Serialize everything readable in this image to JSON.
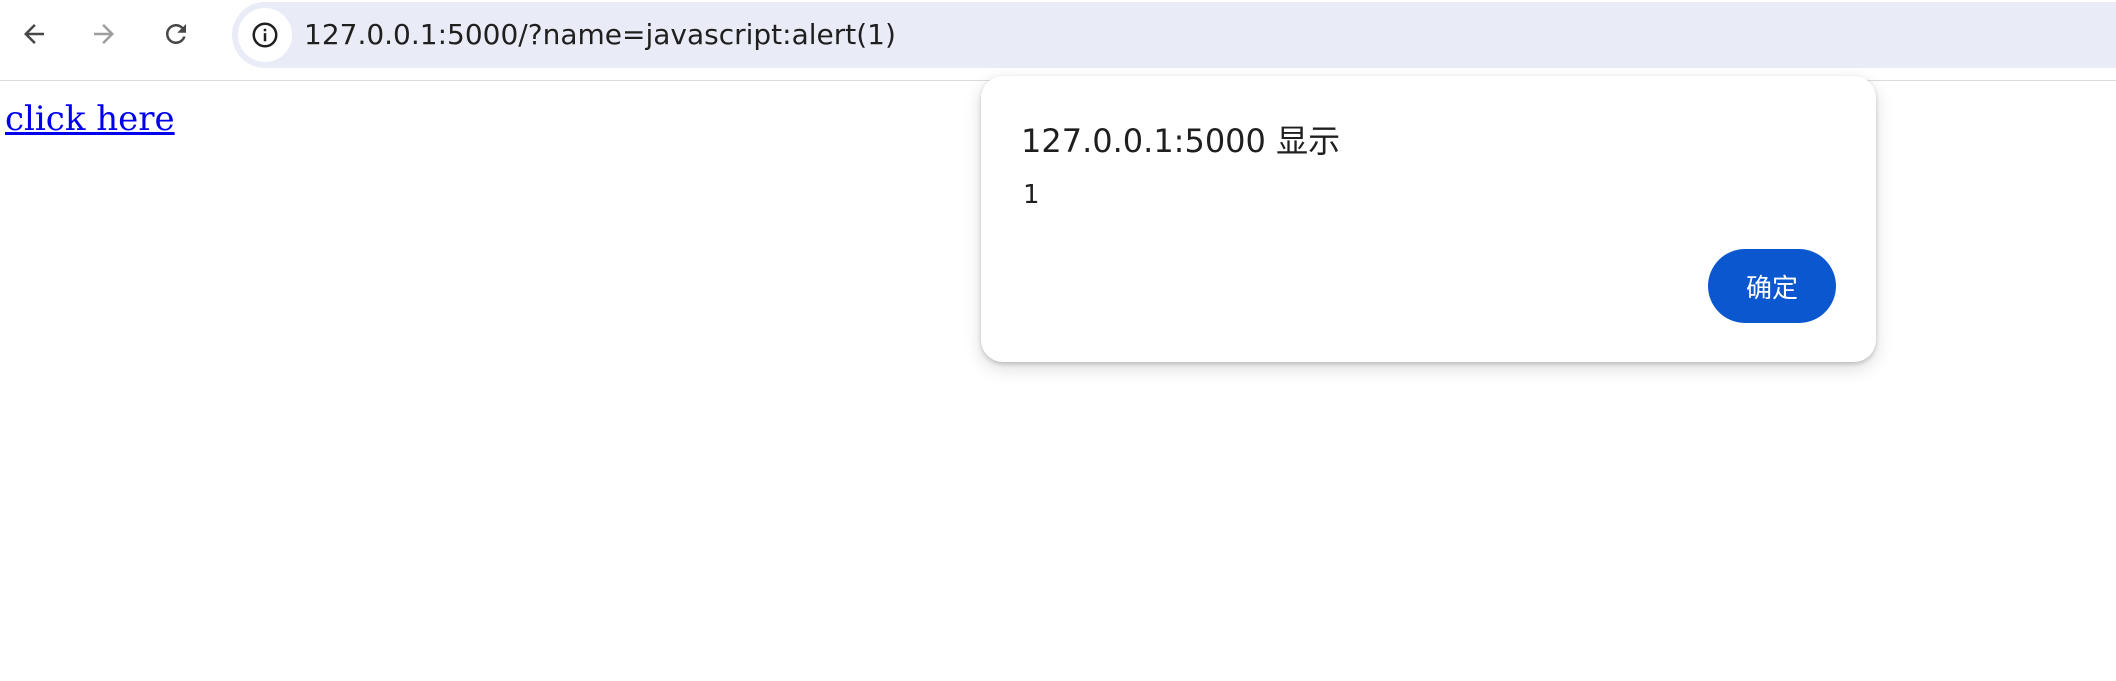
{
  "browser": {
    "url": "127.0.0.1:5000/?name=javascript:alert(1)",
    "nav": {
      "back_icon": "arrow-left-icon",
      "forward_icon": "arrow-right-icon",
      "reload_icon": "reload-icon",
      "site_info_icon": "info-icon"
    },
    "colors": {
      "omnibox_bg": "#e9ecf6",
      "icon_active": "#474747",
      "icon_disabled": "#9e9e9e"
    }
  },
  "page": {
    "link_text": "click here",
    "link_color": "#0000ee"
  },
  "dialog": {
    "title": "127.0.0.1:5000 显示",
    "message": "1",
    "ok_label": "确定",
    "button_color": "#0b57d0"
  }
}
